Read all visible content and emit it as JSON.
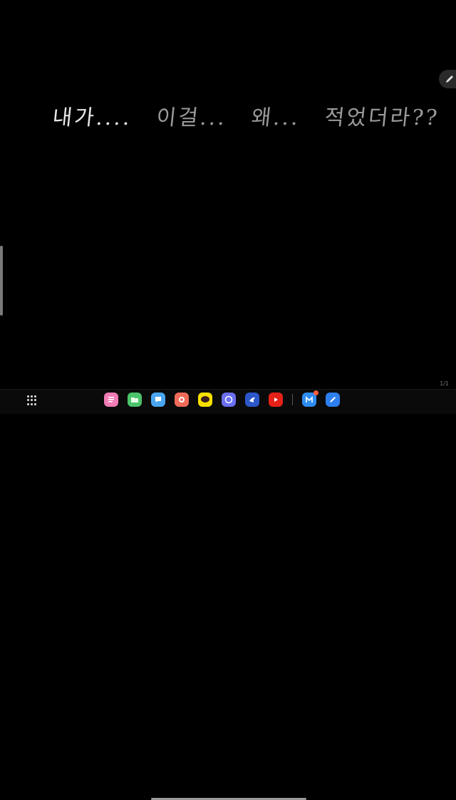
{
  "note": {
    "handwriting_segments": [
      "내가....",
      "이걸...",
      "왜...",
      "적었더라??"
    ]
  },
  "page_indicator": "1/1",
  "taskbar": {
    "apps": [
      {
        "name": "notes",
        "color": "#f07bb5",
        "icon": "notes-icon"
      },
      {
        "name": "files",
        "color": "#4cc46b",
        "icon": "folder-icon"
      },
      {
        "name": "messages",
        "color": "#4aa6f0",
        "icon": "message-icon"
      },
      {
        "name": "camera",
        "color": "#f26b5a",
        "icon": "camera-icon"
      },
      {
        "name": "kakaotalk",
        "color": "#f9e000",
        "icon": "kakaotalk-icon"
      },
      {
        "name": "internet",
        "color": "#6a6ff0",
        "icon": "internet-icon"
      },
      {
        "name": "galaxy-store",
        "color": "#2b57c9",
        "icon": "store-icon"
      },
      {
        "name": "youtube",
        "color": "#e62117",
        "icon": "youtube-icon"
      },
      {
        "name": "myfiles-app",
        "color": "#2f8cf0",
        "icon": "m-app-icon",
        "badge": true
      },
      {
        "name": "sketch",
        "color": "#2d7ff0",
        "icon": "pen-app-icon"
      }
    ]
  }
}
